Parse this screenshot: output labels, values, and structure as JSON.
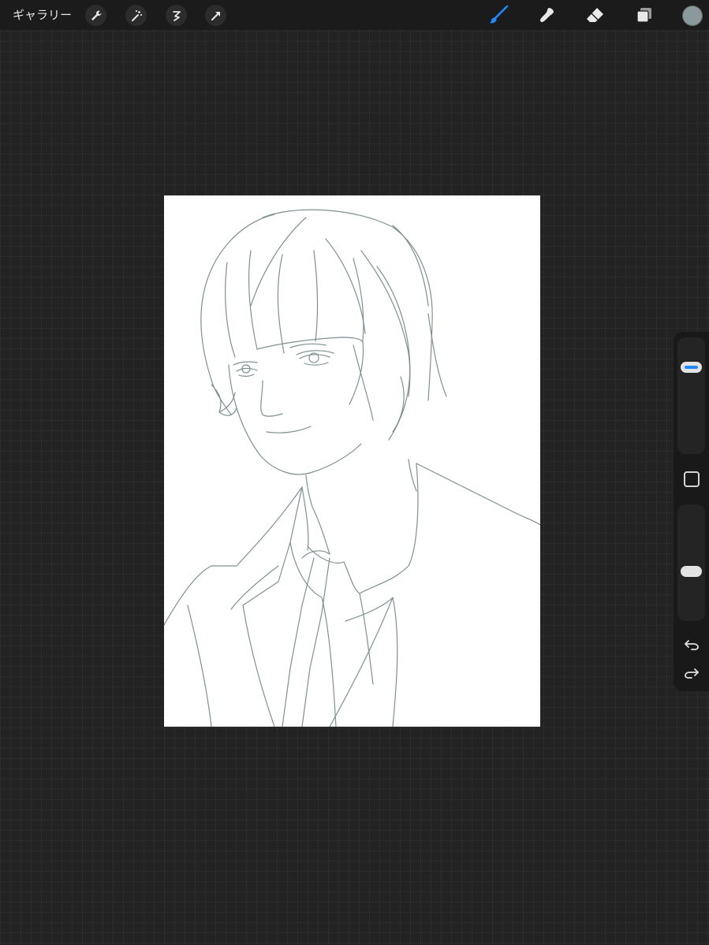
{
  "toolbar": {
    "gallery_label": "ギャラリー",
    "left_tools": [
      "actions-icon",
      "adjustments-icon",
      "selection-icon",
      "transform-icon"
    ],
    "right_tools": [
      "brush-icon",
      "smudge-icon",
      "eraser-icon",
      "layers-icon"
    ],
    "active_tool": "brush-icon",
    "current_color": "#8a9a9a"
  },
  "sidebar": {
    "brush_size_level": 0.23,
    "opacity_level": 0.58,
    "accent_color": "#1f88ff"
  },
  "canvas": {
    "background": "#ffffff",
    "stroke_color": "#7f9090"
  }
}
